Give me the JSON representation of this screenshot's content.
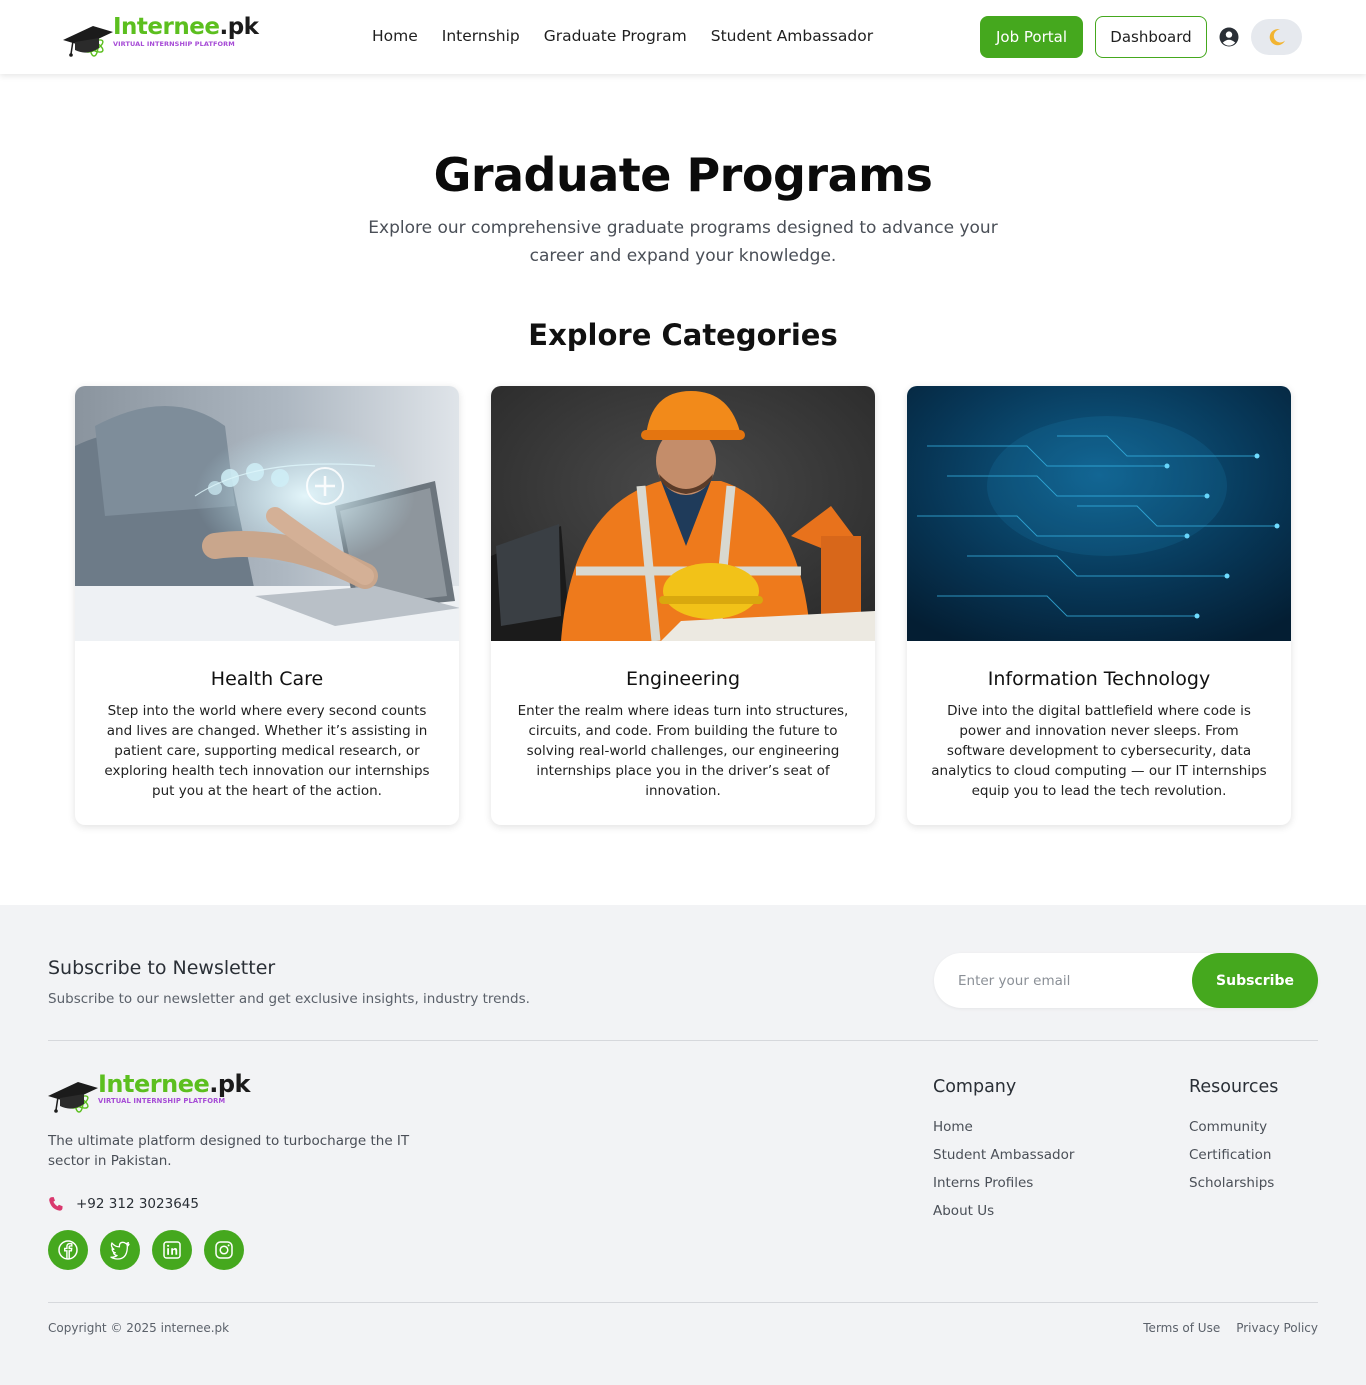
{
  "header": {
    "logo": {
      "brand_green": "Internee",
      "brand_dark": ".pk",
      "tagline": "VIRTUAL INTERNSHIP PLATFORM"
    },
    "nav": [
      "Home",
      "Internship",
      "Graduate Program",
      "Student Ambassador"
    ],
    "job_portal_label": "Job Portal",
    "dashboard_label": "Dashboard",
    "user_icon": "user-circle-icon",
    "theme_icon": "moon-icon"
  },
  "hero": {
    "title": "Graduate Programs",
    "subtitle": "Explore our comprehensive graduate programs designed to advance your career and expand your knowledge."
  },
  "categories": {
    "title": "Explore Categories",
    "items": [
      {
        "title": "Health Care",
        "description": "Step into the world where every second counts and lives are changed. Whether it’s assisting in patient care, supporting medical research, or exploring health tech innovation our internships put you at the heart of the action."
      },
      {
        "title": "Engineering",
        "description": "Enter the realm where ideas turn into structures, circuits, and code. From building the future to solving real-world challenges, our engineering internships place you in the driver’s seat of innovation."
      },
      {
        "title": "Information Technology",
        "description": "Dive into the digital battlefield where code is power and innovation never sleeps. From software development to cybersecurity, data analytics to cloud computing — our IT internships equip you to lead the tech revolution."
      }
    ]
  },
  "footer": {
    "newsletter": {
      "title": "Subscribe to Newsletter",
      "subtitle": "Subscribe to our newsletter and get exclusive insights, industry trends.",
      "placeholder": "Enter your email",
      "button": "Subscribe"
    },
    "logo": {
      "brand_green": "Internee",
      "brand_dark": ".pk",
      "tagline": "VIRTUAL INTERNSHIP PLATFORM"
    },
    "description": "The ultimate platform designed to turbocharge the IT sector in Pakistan.",
    "phone": "+92 312 3023645",
    "socials": [
      "facebook-icon",
      "twitter-icon",
      "linkedin-icon",
      "instagram-icon"
    ],
    "company": {
      "title": "Company",
      "links": [
        "Home",
        "Student Ambassador",
        "Interns Profiles",
        "About Us"
      ]
    },
    "resources": {
      "title": "Resources",
      "links": [
        "Community",
        "Certification",
        "Scholarships"
      ]
    },
    "copyright": "Copyright © 2025 internee.pk",
    "legal": [
      "Terms of Use",
      "Privacy Policy"
    ]
  },
  "colors": {
    "accent": "#45a81e",
    "brand_green": "#5cbf1f",
    "tagline_purple": "#a64bd6",
    "footer_bg": "#f2f3f5"
  }
}
